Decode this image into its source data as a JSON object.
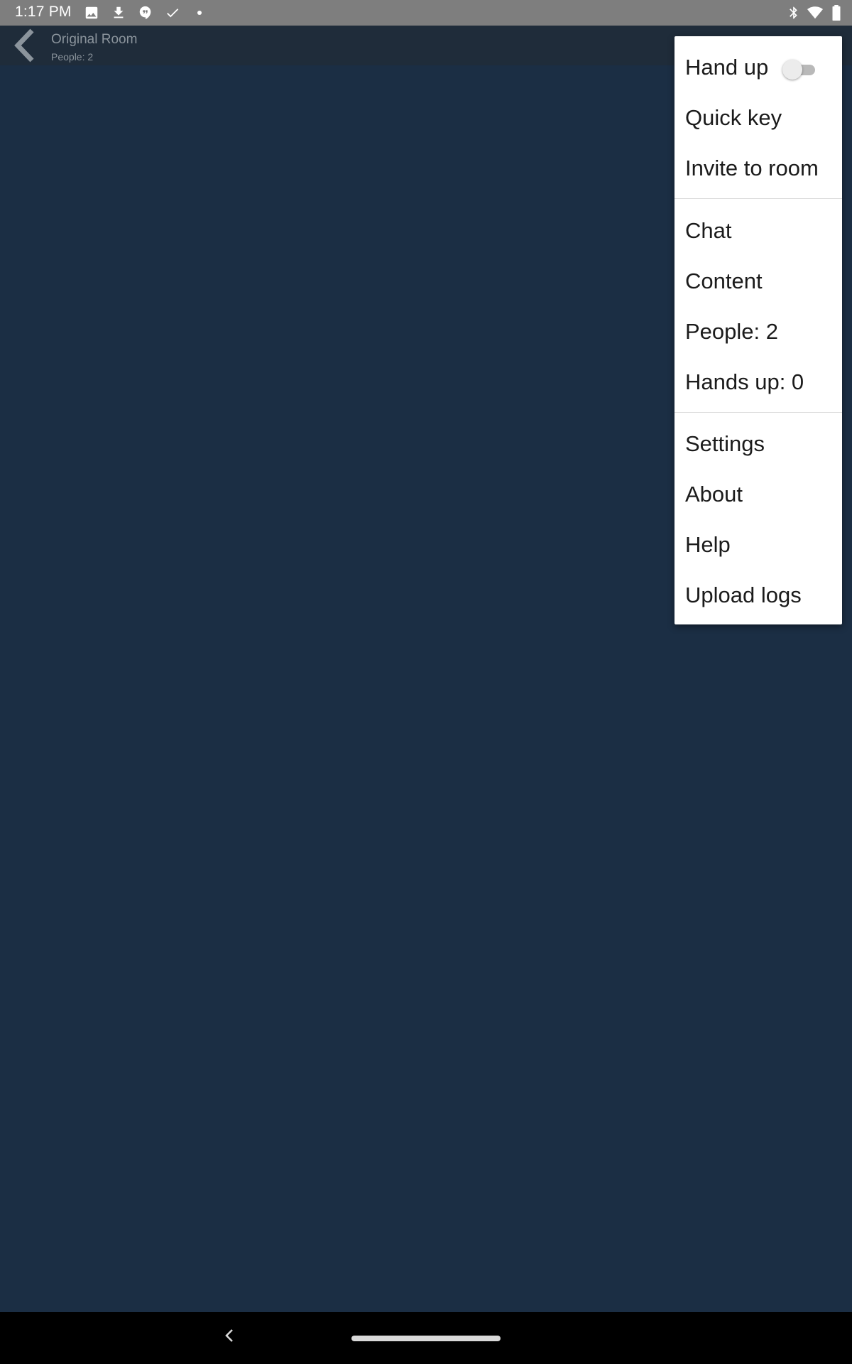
{
  "status_bar": {
    "time": "1:17 PM",
    "left_icons": [
      "image-icon",
      "download-icon",
      "hangouts-icon",
      "check-icon",
      "dot-icon"
    ],
    "right_icons": [
      "bluetooth-icon",
      "wifi-icon",
      "battery-icon"
    ]
  },
  "app_bar": {
    "title": "Original Room",
    "subtitle": "People: 2",
    "icons": [
      "back-arrow-icon",
      "person-icon",
      "volume-icon",
      "more-vert-icon"
    ]
  },
  "menu": {
    "hand_up": {
      "label": "Hand up",
      "toggle_on": false
    },
    "quick_key": "Quick key",
    "invite": "Invite to room",
    "chat": "Chat",
    "content": "Content",
    "people": "People: 2",
    "hands_up": "Hands up: 0",
    "settings": "Settings",
    "about": "About",
    "help": "Help",
    "upload_logs": "Upload logs"
  },
  "colors": {
    "background": "#1b2e44",
    "app_bar": "#1f2c3a",
    "status_bar": "#7e7e7e",
    "menu_background": "#ffffff",
    "menu_text": "#1b1b1b"
  },
  "nav_bar": {
    "icons": [
      "nav-back-icon",
      "home-pill"
    ]
  }
}
